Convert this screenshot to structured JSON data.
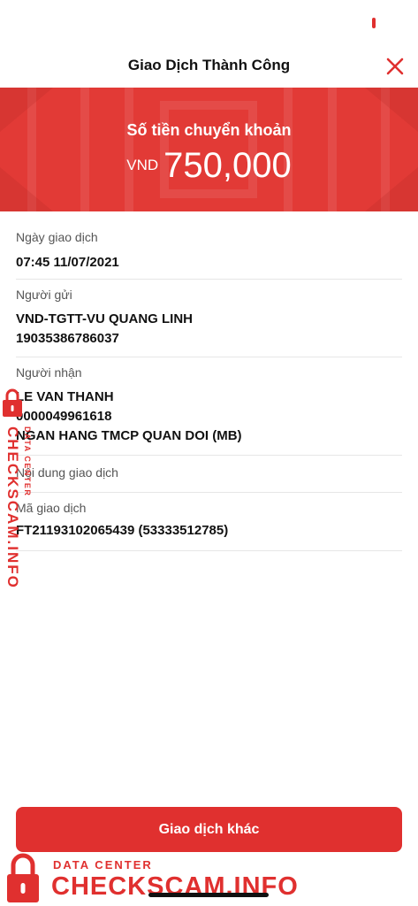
{
  "header": {
    "title": "Giao Dịch Thành Công",
    "close_icon": "close-icon"
  },
  "banner": {
    "label": "Số tiền chuyển khoản",
    "currency": "VND",
    "amount": "750,000"
  },
  "details": {
    "date": {
      "label": "Ngày giao dịch",
      "value": "07:45 11/07/2021"
    },
    "sender": {
      "label": "Người gửi",
      "name": "VND-TGTT-VU QUANG LINH",
      "account": "19035386786037"
    },
    "recipient": {
      "label": "Người nhận",
      "name": "LE VAN THANH",
      "account": "0000049961618",
      "bank": "NGAN HANG TMCP QUAN DOI (MB)"
    },
    "content": {
      "label": "Nội dung giao dịch"
    },
    "transaction_id": {
      "label": "Mã giao dịch",
      "value": "FT21193102065439 (53333512785)"
    }
  },
  "actions": {
    "other_transaction": "Giao dịch khác"
  },
  "watermark": {
    "small": "DATA CENTER",
    "big": "CHECKSCAM.INFO",
    "icon": "lock-icon"
  },
  "colors": {
    "accent": "#e0302f",
    "banner": "#e23a36"
  }
}
